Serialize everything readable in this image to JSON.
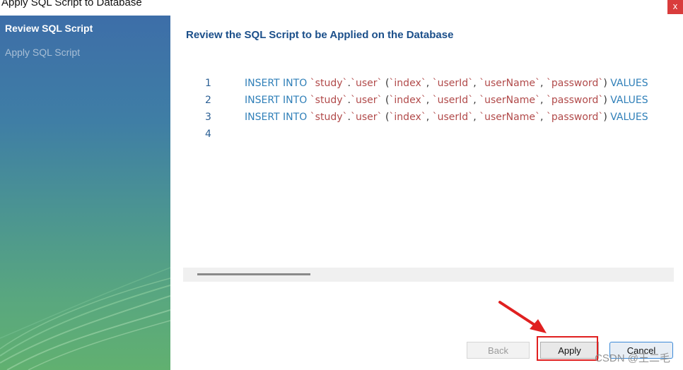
{
  "window": {
    "title": "Apply SQL Script to Database",
    "close_glyph": "x"
  },
  "sidebar": {
    "items": [
      {
        "label": "Review SQL Script",
        "state": "active"
      },
      {
        "label": "Apply SQL Script",
        "state": "inactive"
      }
    ]
  },
  "main": {
    "heading": "Review the SQL Script to be Applied on the Database"
  },
  "editor": {
    "lines": [
      {
        "num": "1",
        "kw1": "INSERT INTO ",
        "db": "`study`",
        "dot": ".",
        "table": "`user`",
        "open": " (",
        "c1": "`index`",
        "sep1": ", ",
        "c2": "`userId`",
        "sep2": ", ",
        "c3": "`userName`",
        "sep3": ", ",
        "c4": "`password`",
        "close": ") ",
        "kw2": "VALUES"
      },
      {
        "num": "2",
        "kw1": "INSERT INTO ",
        "db": "`study`",
        "dot": ".",
        "table": "`user`",
        "open": " (",
        "c1": "`index`",
        "sep1": ", ",
        "c2": "`userId`",
        "sep2": ", ",
        "c3": "`userName`",
        "sep3": ", ",
        "c4": "`password`",
        "close": ") ",
        "kw2": "VALUES"
      },
      {
        "num": "3",
        "kw1": "INSERT INTO ",
        "db": "`study`",
        "dot": ".",
        "table": "`user`",
        "open": " (",
        "c1": "`index`",
        "sep1": ", ",
        "c2": "`userId`",
        "sep2": ", ",
        "c3": "`userName`",
        "sep3": ", ",
        "c4": "`password`",
        "close": ") ",
        "kw2": "VALUES"
      },
      {
        "num": "4"
      }
    ]
  },
  "buttons": {
    "back": "Back",
    "apply": "Apply",
    "cancel": "Cancel"
  },
  "watermark": "CSDN @王二毛",
  "colors": {
    "heading": "#1b4f8a",
    "keyword": "#2f7fb8",
    "identifier": "#b14a4a",
    "annotation": "#e02020",
    "cancel_border": "#3c8ad8"
  },
  "icons": {
    "close": "close-icon",
    "annotation_arrow": "arrow-icon"
  }
}
